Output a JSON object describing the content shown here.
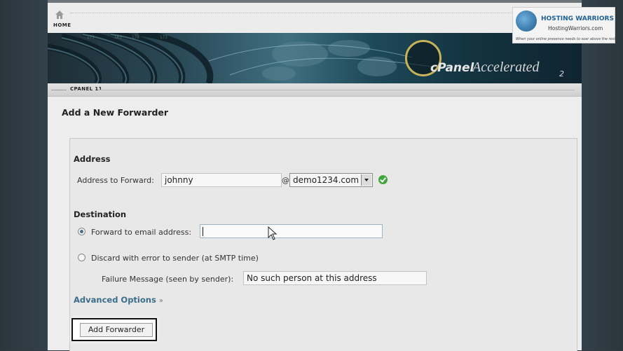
{
  "nav": {
    "home_label": "HOME"
  },
  "banner": {
    "logo_main": "cPanel",
    "logo_accel": "Accelerated",
    "logo_version": "2"
  },
  "breadcrumb": {
    "label": "CPANEL 11"
  },
  "page": {
    "title": "Add a New Forwarder"
  },
  "address": {
    "heading": "Address",
    "forward_label": "Address to Forward:",
    "forward_value": "johnny",
    "at": "@",
    "domain_selected": "demo1234.com",
    "domain_valid": true
  },
  "destination": {
    "heading": "Destination",
    "forward_email_label": "Forward to email address:",
    "forward_email_value": "",
    "forward_email_selected": true,
    "discard_label": "Discard with error to sender (at SMTP time)",
    "discard_selected": false,
    "failure_label": "Failure Message (seen by sender):",
    "failure_value": "No such person at this address"
  },
  "advanced": {
    "label": "Advanced Options",
    "chevron": "»"
  },
  "submit": {
    "label": "Add Forwarder"
  },
  "watermark": {
    "title": "HOSTING WARRIORS",
    "url": "HostingWarriors.com",
    "tagline": "When your online presence needs to soar above the rest!"
  },
  "colors": {
    "link": "#3a6d8a",
    "check_ok": "#3fa63c",
    "sidebar": "#2f3a40"
  }
}
